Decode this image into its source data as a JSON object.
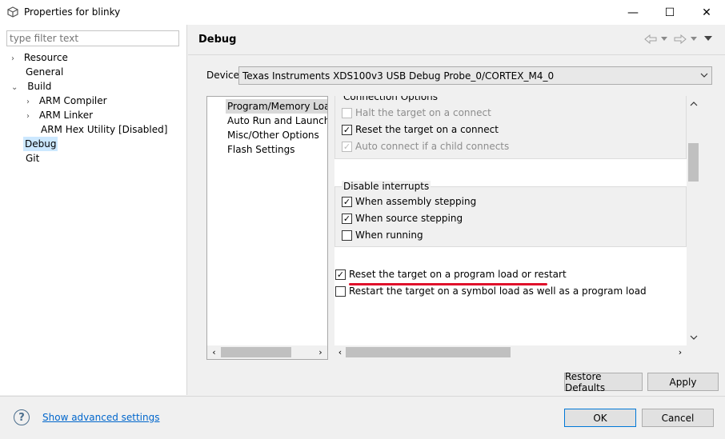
{
  "window": {
    "title": "Properties for blinky",
    "minimize_icon": "—",
    "maximize_icon": "☐",
    "close_icon": "✕"
  },
  "filter": {
    "placeholder": "type filter text"
  },
  "tree": [
    {
      "label": "Resource",
      "arrow": "›"
    },
    {
      "label": "General",
      "arrow": ""
    },
    {
      "label": "Build",
      "arrow": "⌄"
    },
    {
      "label": "ARM Compiler",
      "arrow": "›"
    },
    {
      "label": "ARM Linker",
      "arrow": "›"
    },
    {
      "label": "ARM Hex Utility  [Disabled]",
      "arrow": ""
    },
    {
      "label": "Debug",
      "arrow": ""
    },
    {
      "label": "Git",
      "arrow": ""
    }
  ],
  "page": {
    "title": "Debug"
  },
  "device": {
    "label": "Device",
    "value": "Texas Instruments XDS100v3 USB Debug Probe_0/CORTEX_M4_0"
  },
  "categories": [
    "Program/Memory Load",
    "Auto Run and Launch Op",
    "Misc/Other Options",
    "Flash Settings"
  ],
  "connection_options": {
    "legend": "Connection Options",
    "items": [
      {
        "label": "Halt the target on a connect",
        "checked": false,
        "disabled": true
      },
      {
        "label": "Reset the target on a connect",
        "checked": true,
        "disabled": false
      },
      {
        "label": "Auto connect if a child connects",
        "checked": true,
        "disabled": true
      }
    ]
  },
  "disable_interrupts": {
    "legend": "Disable interrupts",
    "items": [
      {
        "label": "When assembly stepping",
        "checked": true
      },
      {
        "label": "When source stepping",
        "checked": true
      },
      {
        "label": "When running",
        "checked": false
      }
    ]
  },
  "reset_options": [
    {
      "label": "Reset the target on a program load or restart",
      "checked": true
    },
    {
      "label": "Restart the target on a symbol load as well as a program load",
      "checked": false
    }
  ],
  "buttons": {
    "restore_defaults": "Restore Defaults",
    "apply": "Apply",
    "ok": "OK",
    "cancel": "Cancel"
  },
  "bottom": {
    "help_icon": "?",
    "advanced_link": "Show advanced settings"
  },
  "colors": {
    "highlight_underline": "#e0112b",
    "selection": "#cce8ff",
    "link": "#0066cc"
  }
}
